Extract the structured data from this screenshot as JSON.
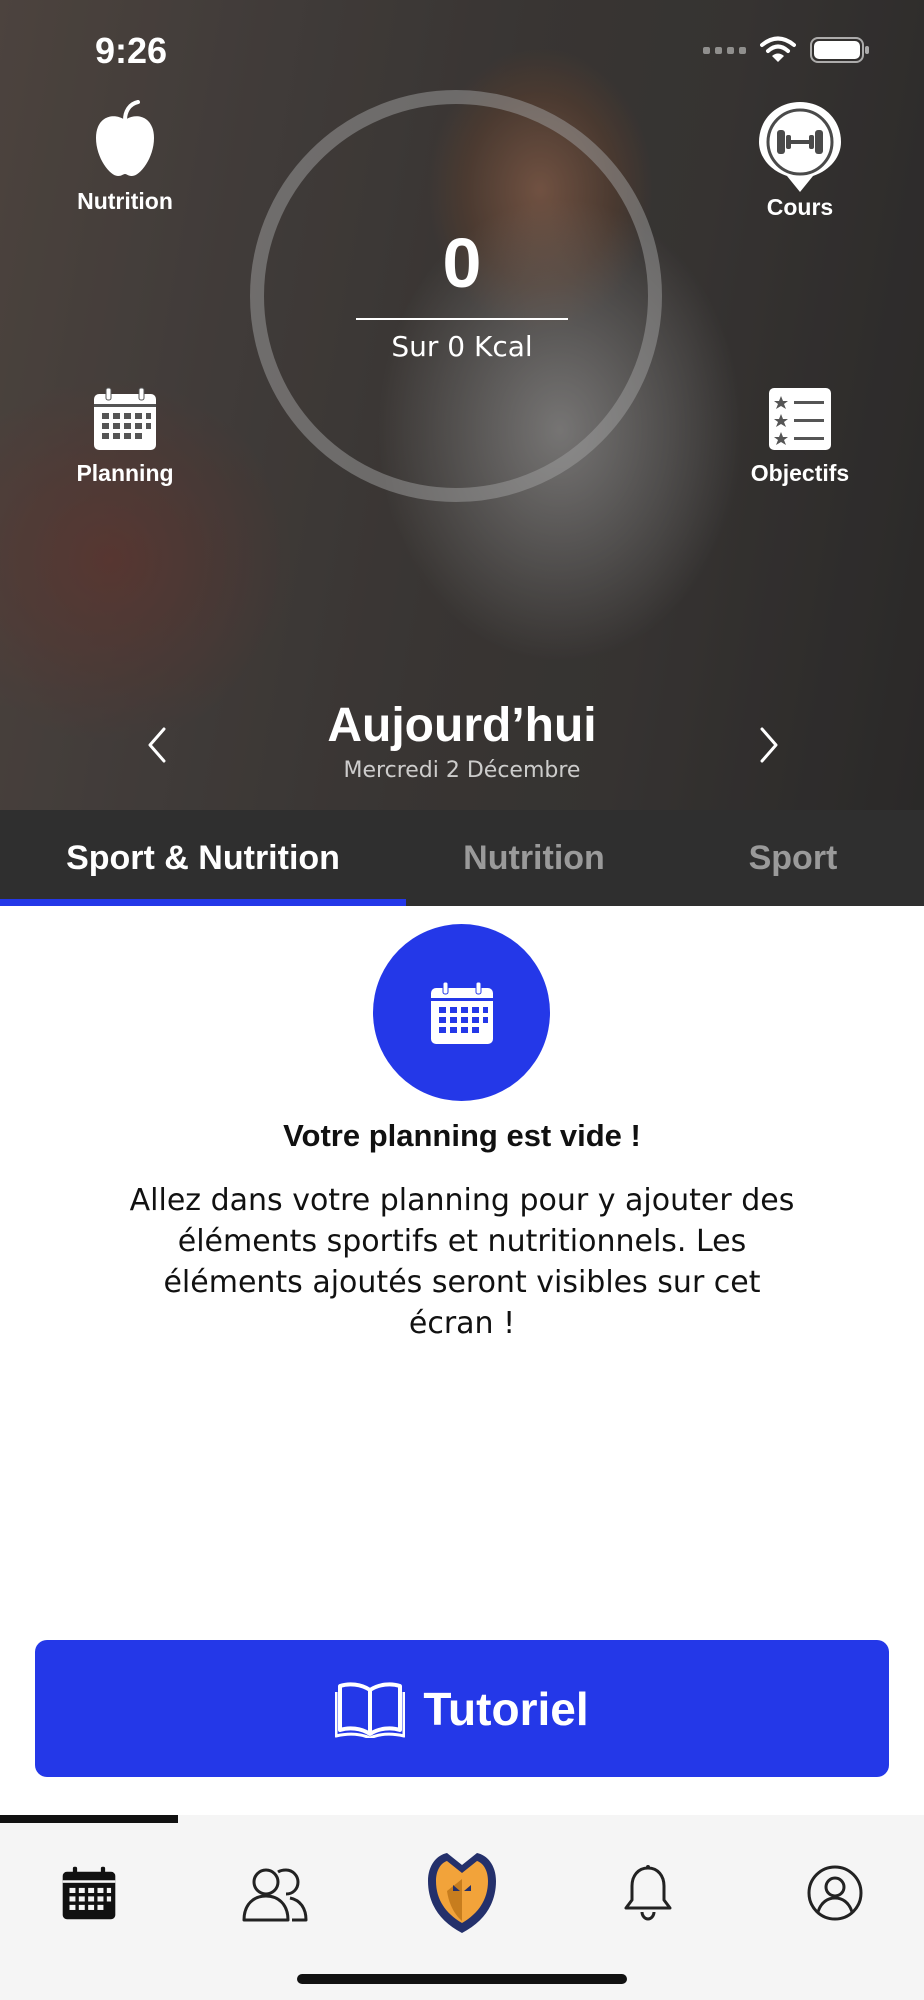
{
  "status": {
    "time": "9:26"
  },
  "hero": {
    "nutrition_label": "Nutrition",
    "cours_label": "Cours",
    "planning_label": "Planning",
    "objectifs_label": "Objectifs",
    "kcal_value": "0",
    "kcal_subtitle": "Sur 0 Kcal",
    "day_title": "Aujourd’hui",
    "day_date": "Mercredi 2 Décembre"
  },
  "tabs": [
    {
      "label": "Sport & Nutrition",
      "active": true
    },
    {
      "label": "Nutrition",
      "active": false
    },
    {
      "label": "Sport",
      "active": false
    }
  ],
  "empty_state": {
    "title": "Votre planning est vide !",
    "message": "Allez dans votre planning pour y ajouter des éléments sportifs et nutritionnels. Les éléments ajoutés seront visibles sur cet écran !"
  },
  "tutorial_button": {
    "label": "Tutoriel"
  },
  "bottom_nav": {
    "items": [
      "calendar-icon",
      "community-icon",
      "app-logo-icon",
      "bell-icon",
      "profile-icon"
    ],
    "active_index": 0
  },
  "colors": {
    "accent": "#2438e8",
    "tab_bar": "#2f2f2f",
    "logo_orange": "#f2a33a",
    "logo_navy": "#24306b"
  }
}
